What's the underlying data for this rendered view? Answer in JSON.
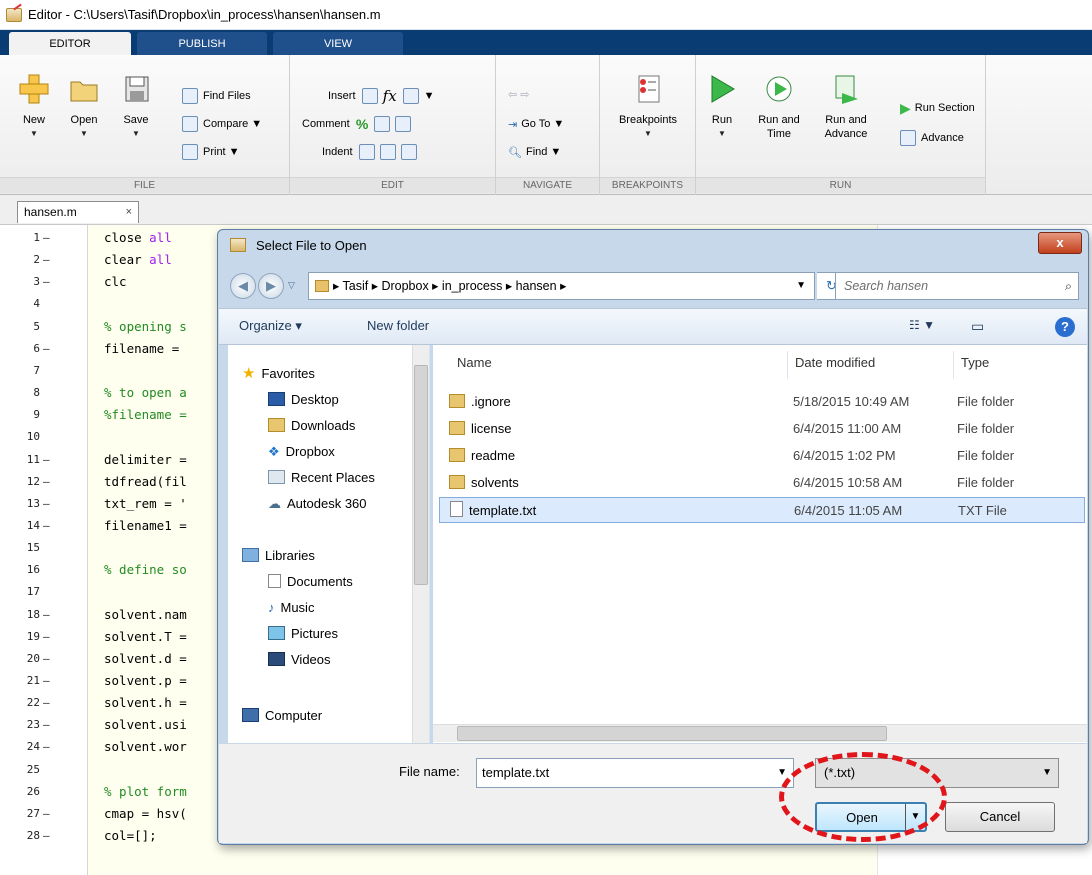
{
  "window": {
    "title": "Editor - C:\\Users\\Tasif\\Dropbox\\in_process\\hansen\\hansen.m"
  },
  "ribbon": {
    "tabs": [
      {
        "label": "EDITOR",
        "active": true
      },
      {
        "label": "PUBLISH",
        "active": false
      },
      {
        "label": "VIEW",
        "active": false
      }
    ],
    "file": {
      "new": "New",
      "open": "Open",
      "save": "Save",
      "find_files": "Find Files",
      "compare": "Compare",
      "print": "Print",
      "group": "FILE"
    },
    "edit": {
      "insert": "Insert",
      "comment": "Comment",
      "indent": "Indent",
      "group": "EDIT"
    },
    "navigate": {
      "goto": "Go To",
      "find": "Find",
      "group": "NAVIGATE"
    },
    "breakpoints": {
      "label": "Breakpoints",
      "group": "BREAKPOINTS"
    },
    "run": {
      "run": "Run",
      "run_and_time_1": "Run and",
      "run_and_time_2": "Time",
      "run_and_advance_1": "Run and",
      "run_and_advance_2": "Advance",
      "run_section": "Run Section",
      "advance": "Advance",
      "group": "RUN"
    }
  },
  "editor": {
    "file_tab": "hansen.m",
    "lines": [
      {
        "n": "1",
        "mark": "–",
        "text": "close all",
        "kind": "kw"
      },
      {
        "n": "2",
        "mark": "–",
        "text": "clear all",
        "kind": "kw"
      },
      {
        "n": "3",
        "mark": "–",
        "text": "clc",
        "kind": "code"
      },
      {
        "n": "4",
        "mark": "",
        "text": "",
        "kind": "code"
      },
      {
        "n": "5",
        "mark": "",
        "text": "% opening s",
        "kind": "comment"
      },
      {
        "n": "6",
        "mark": "–",
        "text": "filename = ",
        "kind": "code"
      },
      {
        "n": "7",
        "mark": "",
        "text": "",
        "kind": "code"
      },
      {
        "n": "8",
        "mark": "",
        "text": "% to open a",
        "kind": "comment"
      },
      {
        "n": "9",
        "mark": "",
        "text": "%filename =",
        "kind": "comment"
      },
      {
        "n": "10",
        "mark": "",
        "text": "",
        "kind": "code"
      },
      {
        "n": "11",
        "mark": "–",
        "text": "delimiter =",
        "kind": "code"
      },
      {
        "n": "12",
        "mark": "–",
        "text": "tdfread(fil",
        "kind": "code"
      },
      {
        "n": "13",
        "mark": "–",
        "text": "txt_rem = '",
        "kind": "code"
      },
      {
        "n": "14",
        "mark": "–",
        "text": "filename1 =",
        "kind": "code"
      },
      {
        "n": "15",
        "mark": "",
        "text": "",
        "kind": "code"
      },
      {
        "n": "16",
        "mark": "",
        "text": "% define so",
        "kind": "comment"
      },
      {
        "n": "17",
        "mark": "",
        "text": "",
        "kind": "code"
      },
      {
        "n": "18",
        "mark": "–",
        "text": "solvent.nam",
        "kind": "code"
      },
      {
        "n": "19",
        "mark": "–",
        "text": "solvent.T =",
        "kind": "code"
      },
      {
        "n": "20",
        "mark": "–",
        "text": "solvent.d =",
        "kind": "code"
      },
      {
        "n": "21",
        "mark": "–",
        "text": "solvent.p =",
        "kind": "code"
      },
      {
        "n": "22",
        "mark": "–",
        "text": "solvent.h =",
        "kind": "code"
      },
      {
        "n": "23",
        "mark": "–",
        "text": "solvent.usi",
        "kind": "code"
      },
      {
        "n": "24",
        "mark": "–",
        "text": "solvent.wor",
        "kind": "code"
      },
      {
        "n": "25",
        "mark": "",
        "text": "",
        "kind": "code"
      },
      {
        "n": "26",
        "mark": "",
        "text": "% plot form",
        "kind": "comment"
      },
      {
        "n": "27",
        "mark": "–",
        "text": "cmap = hsv(",
        "kind": "code"
      },
      {
        "n": "28",
        "mark": "–",
        "text": "col=[];",
        "kind": "code"
      }
    ]
  },
  "dialog": {
    "title": "Select File to Open",
    "close": "x",
    "breadcrumb": "▸ Tasif ▸ Dropbox ▸ in_process ▸ hansen ▸",
    "search_placeholder": "Search hansen",
    "organize": "Organize ▾",
    "new_folder": "New folder",
    "nav": {
      "favorites": "Favorites",
      "favorites_items": [
        "Desktop",
        "Downloads",
        "Dropbox",
        "Recent Places",
        "Autodesk 360"
      ],
      "libraries": "Libraries",
      "libraries_items": [
        "Documents",
        "Music",
        "Pictures",
        "Videos"
      ],
      "computer": "Computer"
    },
    "columns": {
      "name": "Name",
      "date": "Date modified",
      "type": "Type"
    },
    "files": [
      {
        "name": ".ignore",
        "date": "5/18/2015 10:49 AM",
        "type": "File folder",
        "selected": false
      },
      {
        "name": "license",
        "date": "6/4/2015 11:00 AM",
        "type": "File folder",
        "selected": false
      },
      {
        "name": "readme",
        "date": "6/4/2015 1:02 PM",
        "type": "File folder",
        "selected": false
      },
      {
        "name": "solvents",
        "date": "6/4/2015 10:58 AM",
        "type": "File folder",
        "selected": false
      },
      {
        "name": "template.txt",
        "date": "6/4/2015 11:05 AM",
        "type": "TXT File",
        "selected": true
      }
    ],
    "file_name_label": "File name:",
    "file_name_value": "template.txt",
    "filter": "(*.txt)",
    "open": "Open",
    "cancel": "Cancel"
  },
  "colors": {
    "accent": "#0a3c74",
    "highlight": "#e0161b"
  }
}
